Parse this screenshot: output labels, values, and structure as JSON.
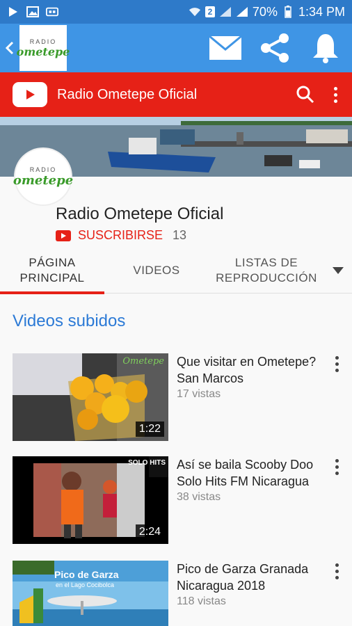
{
  "status_bar": {
    "battery": "70%",
    "time": "1:34 PM",
    "sim": "2"
  },
  "app_bar": {
    "logo_top": "RADIO",
    "logo_main": "ometepe"
  },
  "youtube_bar": {
    "title": "Radio Ometepe Oficial"
  },
  "channel": {
    "avatar_top": "RADIO",
    "avatar_main": "ometepe",
    "name": "Radio Ometepe Oficial",
    "subscribe_label": "SUSCRIBIRSE",
    "subscriber_count": "13"
  },
  "tabs": [
    {
      "label_line1": "PÁGINA",
      "label_line2": "PRINCIPAL"
    },
    {
      "label_line1": "VIDEOS",
      "label_line2": ""
    },
    {
      "label_line1": "LISTAS DE",
      "label_line2": "REPRODUCCIÓN"
    }
  ],
  "section_title": "Videos subidos",
  "videos": [
    {
      "title": "Que visitar en Ometepe? San Marcos",
      "views": "17 vistas",
      "duration": "1:22",
      "thumb_watermark": "Ometepe"
    },
    {
      "title": "Así se baila Scooby Doo Solo Hits FM Nicaragua",
      "views": "38 vistas",
      "duration": "2:24",
      "thumb_watermark": "SOLO HITS"
    },
    {
      "title": "Pico de Garza Granada Nicaragua 2018",
      "views": "118 vistas",
      "duration": "",
      "thumb_text1": "Pico de Garza",
      "thumb_text2": "en el Lago Cocibolca"
    }
  ],
  "colors": {
    "status_bar": "#2e7ac9",
    "app_bar": "#3f95e5",
    "youtube_red": "#e62117",
    "section_title": "#2c7ad6"
  }
}
